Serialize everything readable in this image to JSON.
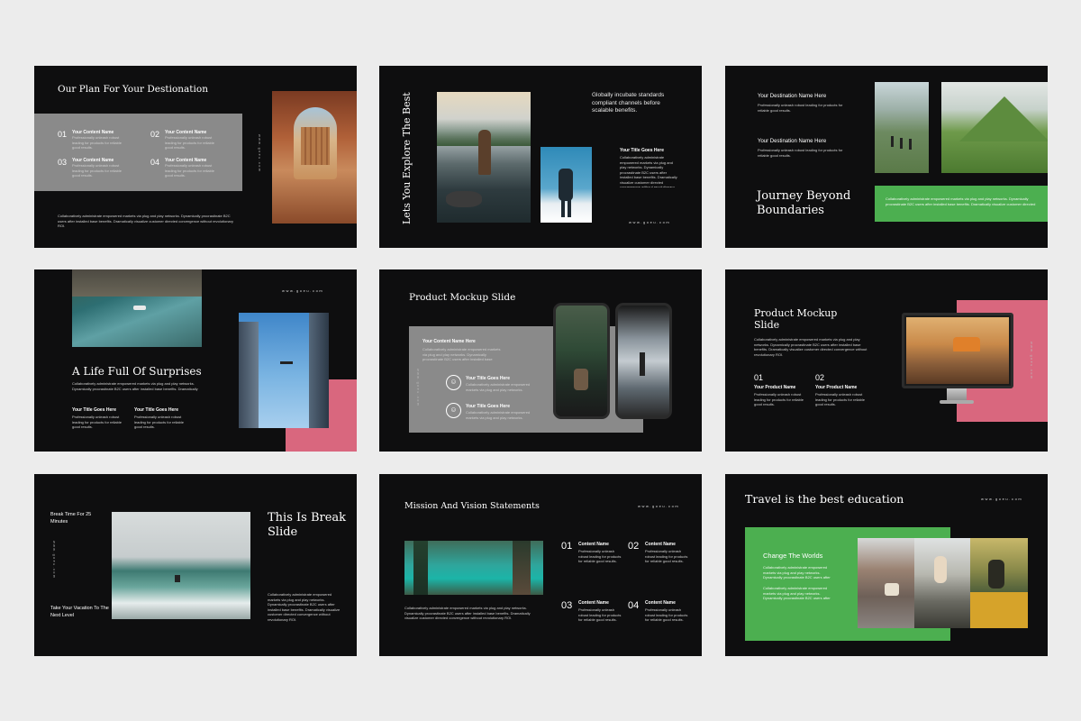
{
  "colors": {
    "background": "#ececec",
    "slide": "#0e0e0f",
    "gray_panel": "#8a8a8a",
    "green": "#4caf50",
    "pink": "#d9677e"
  },
  "url_text": "www.goeu.com",
  "placeholder_para": "Professionally unleash robust leading for products for reliable good results.",
  "long_para": "Collaboratively administrate empowered markets via plug and play networks. Dynamically procrastinate B2C users after installed base benefits. Dramatically visualize customer directed convergence without revolutionary ROI.",
  "s1": {
    "title": "Our Plan For Your Destionation",
    "items": [
      {
        "num": "01",
        "label": "Your Content Name"
      },
      {
        "num": "02",
        "label": "Your Content Name"
      },
      {
        "num": "03",
        "label": "Your Content Name"
      },
      {
        "num": "04",
        "label": "Your Content Name"
      }
    ]
  },
  "s2": {
    "vertical_title": "Lets You Explore The Best",
    "intro": "Globally incubate standards compliant channels before scalable benefits.",
    "sub_label": "Your Title Goes Here"
  },
  "s3": {
    "dest1": "Your Destination Name Here",
    "dest2": "Your Destination Name Here",
    "title": "Journey Beyond Boundaries"
  },
  "s4": {
    "title": "A Life Full Of Surprises",
    "col1": "Your Title Goes Here",
    "col2": "Your Title Goes Here"
  },
  "s5": {
    "title": "Product  Mockup Slide",
    "panel_label": "Your Content Name Here",
    "item1": "Your Title Goes Here",
    "item2": "Your Title Goes Here"
  },
  "s6": {
    "title": "Product Mockup Slide",
    "items": [
      {
        "num": "01",
        "label": "Your Product Name"
      },
      {
        "num": "02",
        "label": "Your Product Name"
      }
    ]
  },
  "s7": {
    "break_time": "Break Time For 25 Minutes",
    "vacation": "Take Your Vacation To The Next Level",
    "title": "This Is Break Slide"
  },
  "s8": {
    "title": "Mission And Vision Statements",
    "items": [
      {
        "num": "01",
        "label": "Content Name"
      },
      {
        "num": "02",
        "label": "Content Name"
      },
      {
        "num": "03",
        "label": "Content Name"
      },
      {
        "num": "04",
        "label": "Content Name"
      }
    ]
  },
  "s9": {
    "title": "Travel is the best education",
    "panel_title": "Change The Worlds"
  }
}
